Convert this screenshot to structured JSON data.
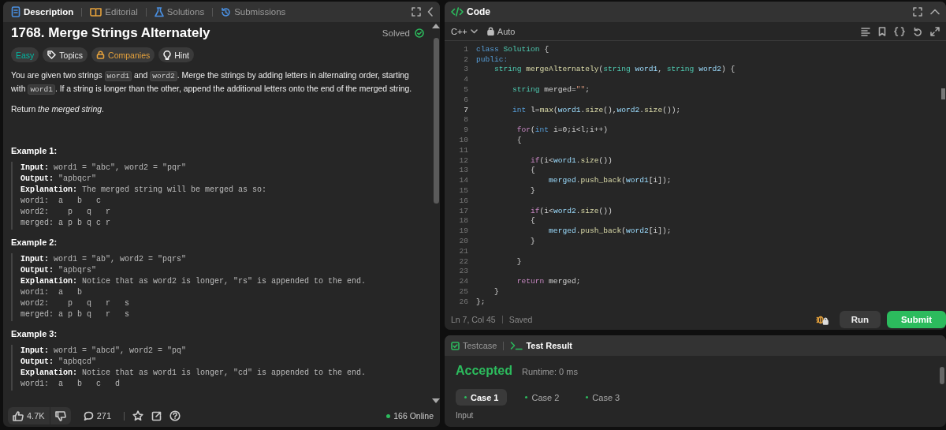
{
  "description_panel": {
    "tabs": [
      {
        "label": "Description",
        "selected": true
      },
      {
        "label": "Editorial",
        "selected": false
      },
      {
        "label": "Solutions",
        "selected": false
      },
      {
        "label": "Submissions",
        "selected": false
      }
    ],
    "title": "1768. Merge Strings Alternately",
    "status": "Solved",
    "tags": [
      {
        "label": "Easy",
        "kind": "difficulty"
      },
      {
        "label": "Topics",
        "kind": "topics"
      },
      {
        "label": "Companies",
        "kind": "premium"
      },
      {
        "label": "Hint",
        "kind": "hint"
      }
    ],
    "paragraphs": [
      [
        {
          "kind": "text",
          "text": "You are given two strings "
        },
        {
          "kind": "code",
          "text": "word1"
        },
        {
          "kind": "text",
          "text": " and "
        },
        {
          "kind": "code",
          "text": "word2"
        },
        {
          "kind": "text",
          "text": ". Merge the strings by adding letters in alternating order, starting with "
        },
        {
          "kind": "code",
          "text": "word1"
        },
        {
          "kind": "text",
          "text": ". If a string is longer than the other, append the additional letters onto the end of the merged string."
        }
      ],
      [
        {
          "kind": "text",
          "text": "Return *the merged string*."
        }
      ]
    ],
    "examples": [
      {
        "title": "Example 1:",
        "lines": [
          "**Input:** word1 = \"abc\", word2 = \"pqr\"",
          "**Output:** \"apbqcr\"",
          "**Explanation:** The merged string will be merged as so:",
          "word1:  a   b   c",
          "word2:    p   q   r",
          "merged: a p b q c r"
        ]
      },
      {
        "title": "Example 2:",
        "lines": [
          "**Input:** word1 = \"ab\", word2 = \"pqrs\"",
          "**Output:** \"apbqrs\"",
          "**Explanation:** Notice that as word2 is longer, \"rs\" is appended to the end.",
          "word1:  a   b ",
          "word2:    p   q   r   s",
          "merged: a p b q   r   s"
        ]
      },
      {
        "title": "Example 3:",
        "lines": [
          "**Input:** word1 = \"abcd\", word2 = \"pq\"",
          "**Output:** \"apbqcd\"",
          "**Explanation:** Notice that as word1 is longer, \"cd\" is appended to the end.",
          "word1:  a   b   c   d"
        ]
      }
    ],
    "footer": {
      "likes": "4.7K",
      "comments": "271",
      "online": "166 Online"
    }
  },
  "code_panel": {
    "title": "Code",
    "language": "C++",
    "mode": "Auto",
    "lines": [
      {
        "number": "1",
        "current": false,
        "tokens": [
          {
            "kind": "kw",
            "text": "class"
          },
          {
            "kind": "type",
            "text": " Solution"
          },
          {
            "kind": "pl",
            "text": " {"
          }
        ]
      },
      {
        "number": "2",
        "current": false,
        "tokens": [
          {
            "kind": "kw",
            "text": "public:"
          }
        ]
      },
      {
        "number": "3",
        "current": false,
        "tokens": [
          {
            "kind": "type",
            "text": "    string"
          },
          {
            "kind": "fn",
            "text": " mergeAlternately"
          },
          {
            "kind": "pl",
            "text": "("
          },
          {
            "kind": "type",
            "text": "string"
          },
          {
            "kind": "var",
            "text": " word1"
          },
          {
            "kind": "pl",
            "text": ", "
          },
          {
            "kind": "type",
            "text": "string"
          },
          {
            "kind": "var",
            "text": " word2"
          },
          {
            "kind": "pl",
            "text": ") {"
          }
        ]
      },
      {
        "number": "4",
        "current": false
      },
      {
        "number": "5",
        "current": false,
        "tokens": [
          {
            "kind": "type",
            "text": "        string"
          },
          {
            "kind": "pl",
            "text": " merged="
          },
          {
            "kind": "str",
            "text": "\"\""
          },
          {
            "kind": "pl",
            "text": ";"
          }
        ]
      },
      {
        "number": "6",
        "current": false
      },
      {
        "number": "7",
        "current": true,
        "tokens": [
          {
            "kind": "kw",
            "text": "        int"
          },
          {
            "kind": "pl",
            "text": " l="
          },
          {
            "kind": "fn",
            "text": "max"
          },
          {
            "kind": "pl",
            "text": "("
          },
          {
            "kind": "var",
            "text": "word1"
          },
          {
            "kind": "pl",
            "text": "."
          },
          {
            "kind": "fn",
            "text": "size"
          },
          {
            "kind": "pl",
            "text": "(),"
          },
          {
            "kind": "var",
            "text": "word2"
          },
          {
            "kind": "pl",
            "text": "."
          },
          {
            "kind": "fn",
            "text": "size"
          },
          {
            "kind": "pl",
            "text": "());"
          }
        ]
      },
      {
        "number": "8",
        "current": false
      },
      {
        "number": "9",
        "current": false,
        "tokens": [
          {
            "kind": "ctrl",
            "text": "         for"
          },
          {
            "kind": "pl",
            "text": "("
          },
          {
            "kind": "kw",
            "text": "int"
          },
          {
            "kind": "pl",
            "text": " i=0;i<l;i++)"
          }
        ]
      },
      {
        "number": "10",
        "current": false,
        "tokens": [
          {
            "kind": "pl",
            "text": "         {"
          }
        ]
      },
      {
        "number": "11",
        "current": false
      },
      {
        "number": "12",
        "current": false,
        "tokens": [
          {
            "kind": "ctrl",
            "text": "            if"
          },
          {
            "kind": "pl",
            "text": "(i<"
          },
          {
            "kind": "var",
            "text": "word1"
          },
          {
            "kind": "pl",
            "text": "."
          },
          {
            "kind": "fn",
            "text": "size"
          },
          {
            "kind": "pl",
            "text": "())"
          }
        ]
      },
      {
        "number": "13",
        "current": false,
        "tokens": [
          {
            "kind": "pl",
            "text": "            {"
          }
        ]
      },
      {
        "number": "14",
        "current": false,
        "tokens": [
          {
            "kind": "var",
            "text": "                merged"
          },
          {
            "kind": "pl",
            "text": "."
          },
          {
            "kind": "fn",
            "text": "push_back"
          },
          {
            "kind": "pl",
            "text": "("
          },
          {
            "kind": "var",
            "text": "word1"
          },
          {
            "kind": "pl",
            "text": "[i]);"
          }
        ]
      },
      {
        "number": "15",
        "current": false,
        "tokens": [
          {
            "kind": "pl",
            "text": "            }"
          }
        ]
      },
      {
        "number": "16",
        "current": false
      },
      {
        "number": "17",
        "current": false,
        "tokens": [
          {
            "kind": "ctrl",
            "text": "            if"
          },
          {
            "kind": "pl",
            "text": "(i<"
          },
          {
            "kind": "var",
            "text": "word2"
          },
          {
            "kind": "pl",
            "text": "."
          },
          {
            "kind": "fn",
            "text": "size"
          },
          {
            "kind": "pl",
            "text": "())"
          }
        ]
      },
      {
        "number": "18",
        "current": false,
        "tokens": [
          {
            "kind": "pl",
            "text": "            {"
          }
        ]
      },
      {
        "number": "19",
        "current": false,
        "tokens": [
          {
            "kind": "var",
            "text": "                merged"
          },
          {
            "kind": "pl",
            "text": "."
          },
          {
            "kind": "fn",
            "text": "push_back"
          },
          {
            "kind": "pl",
            "text": "("
          },
          {
            "kind": "var",
            "text": "word2"
          },
          {
            "kind": "pl",
            "text": "[i]);"
          }
        ]
      },
      {
        "number": "20",
        "current": false,
        "tokens": [
          {
            "kind": "pl",
            "text": "            }"
          }
        ]
      },
      {
        "number": "21",
        "current": false
      },
      {
        "number": "22",
        "current": false,
        "tokens": [
          {
            "kind": "pl",
            "text": "         }"
          }
        ]
      },
      {
        "number": "23",
        "current": false
      },
      {
        "number": "24",
        "current": false,
        "tokens": [
          {
            "kind": "ctrl",
            "text": "         return"
          },
          {
            "kind": "pl",
            "text": " merged;"
          }
        ]
      },
      {
        "number": "25",
        "current": false,
        "tokens": [
          {
            "kind": "pl",
            "text": "    }"
          }
        ]
      },
      {
        "number": "26",
        "current": false,
        "tokens": [
          {
            "kind": "pl",
            "text": "};"
          }
        ]
      }
    ],
    "cursor": "Ln 7, Col 45",
    "saved": "Saved",
    "buttons": [
      {
        "label": "Run",
        "kind": "secondary"
      },
      {
        "label": "Submit",
        "kind": "primary"
      }
    ]
  },
  "test_panel": {
    "tabs": [
      {
        "label": "Testcase",
        "selected": false
      },
      {
        "label": "Test Result",
        "selected": true
      }
    ],
    "result": "Accepted",
    "runtime": "Runtime: 0 ms",
    "cases": [
      {
        "label": "Case 1",
        "selected": true,
        "passed": true
      },
      {
        "label": "Case 2",
        "selected": false,
        "passed": true
      },
      {
        "label": "Case 3",
        "selected": false,
        "passed": true
      }
    ],
    "section": "Input"
  }
}
